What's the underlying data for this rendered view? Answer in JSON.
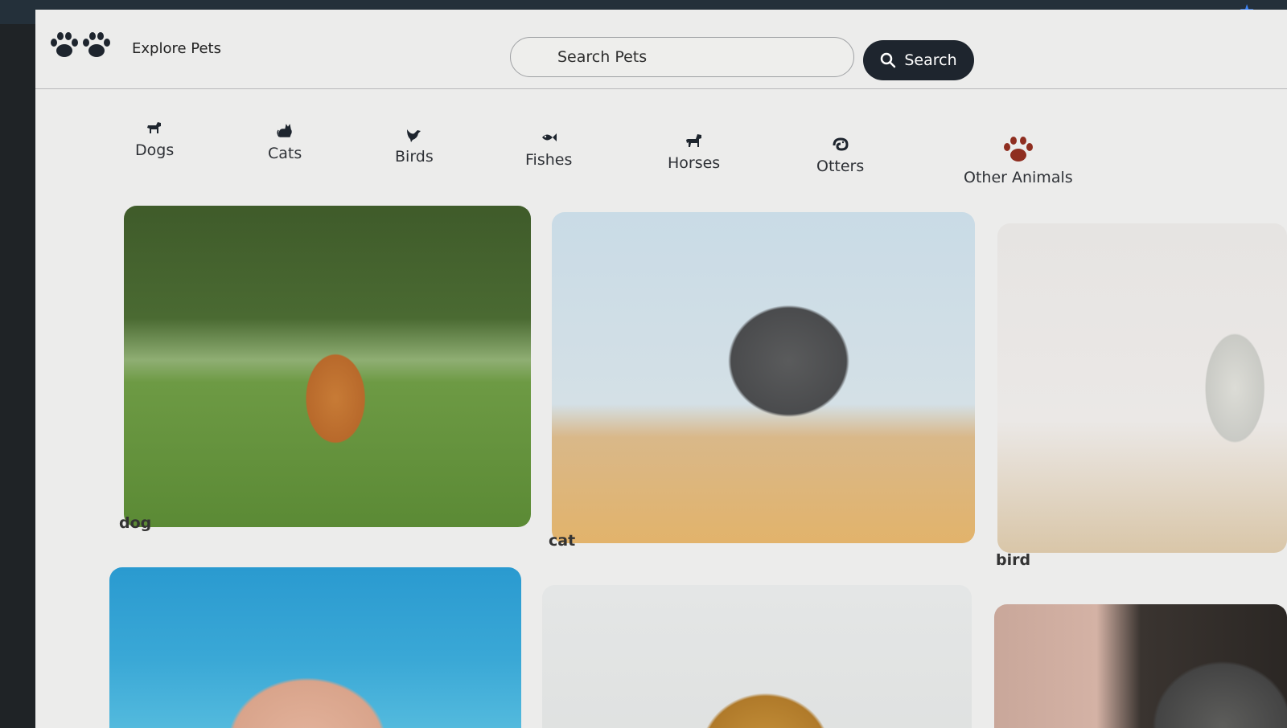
{
  "app": {
    "brand": "Explore Pets",
    "accent_color": "#1e252e",
    "logo_icon": "paw-prints-icon"
  },
  "search": {
    "placeholder": "Search Pets",
    "button_label": "Search",
    "button_icon": "search-icon"
  },
  "categories": [
    {
      "label": "Dogs",
      "icon": "dog-icon"
    },
    {
      "label": "Cats",
      "icon": "cat-icon"
    },
    {
      "label": "Birds",
      "icon": "bird-icon"
    },
    {
      "label": "Fishes",
      "icon": "fish-icon"
    },
    {
      "label": "Horses",
      "icon": "horse-icon"
    },
    {
      "label": "Otters",
      "icon": "otter-icon"
    },
    {
      "label": "Other Animals",
      "icon": "paw-icon"
    }
  ],
  "gallery": [
    {
      "label": "dog"
    },
    {
      "label": "cat"
    },
    {
      "label": "bird"
    },
    {
      "label": ""
    },
    {
      "label": ""
    },
    {
      "label": ""
    }
  ]
}
